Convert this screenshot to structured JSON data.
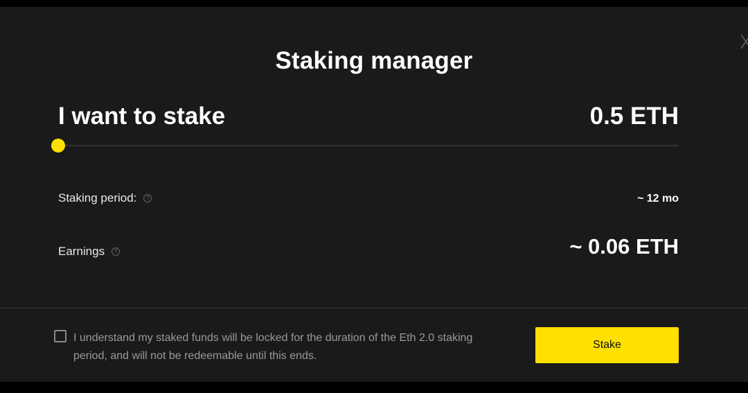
{
  "modal": {
    "title": "Staking manager",
    "close_icon": "close-icon"
  },
  "stake": {
    "label": "I want to stake",
    "amount": "0.5 ETH",
    "slider_fraction": 0
  },
  "period": {
    "label": "Staking period:",
    "value": "~ 12 mo",
    "help_icon": "help-icon"
  },
  "earnings": {
    "label": "Earnings",
    "value": "~ 0.06 ETH",
    "help_icon": "help-icon"
  },
  "consent": {
    "checked": false,
    "text": "I understand my staked funds will be locked for the duration of the Eth 2.0 staking period, and will not be redeemable until this ends."
  },
  "actions": {
    "stake_label": "Stake"
  },
  "colors": {
    "accent": "#ffe000",
    "background": "#1a1a1a"
  }
}
